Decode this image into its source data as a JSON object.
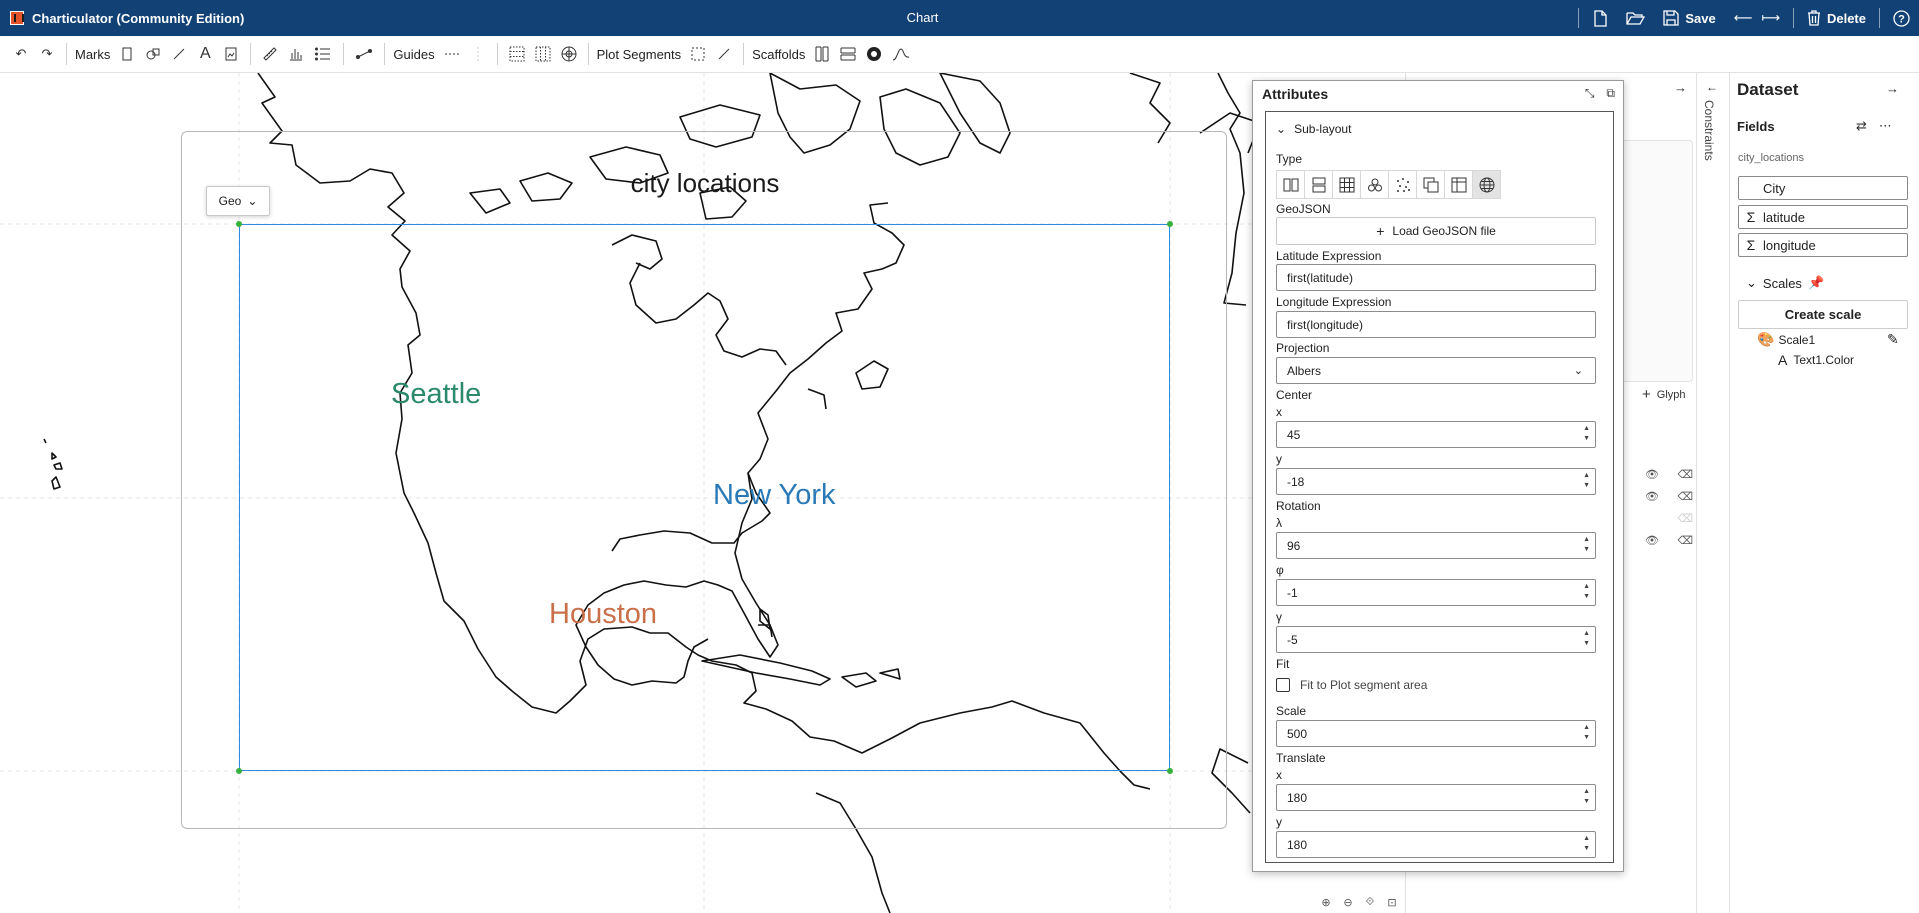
{
  "app": {
    "name": "Charticulator (Community Edition)",
    "document_title": "Chart",
    "actions": {
      "new_icon": "new-file-icon",
      "open_icon": "open-folder-icon",
      "save": "Save",
      "delete": "Delete",
      "help_icon": "help-icon"
    }
  },
  "toolbar": {
    "marks_label": "Marks",
    "guides_label": "Guides",
    "plot_segments_label": "Plot Segments",
    "scaffolds_label": "Scaffolds"
  },
  "canvas": {
    "chart_title": "city locations",
    "geo_dropdown": "Geo",
    "cities": [
      {
        "name": "Seattle",
        "color": "#2b8a6c"
      },
      {
        "name": "New York",
        "color": "#2a7ab7"
      },
      {
        "name": "Houston",
        "color": "#c96f49"
      }
    ]
  },
  "middle_panel": {
    "glyph_label": "Glyph",
    "constraints_label": "Constraints"
  },
  "attributes": {
    "title": "Attributes",
    "section": "Sub-layout",
    "type_label": "Type",
    "geojson_label": "GeoJSON",
    "load_geojson_button": "Load GeoJSON file",
    "latitude_expression_label": "Latitude Expression",
    "latitude_expression_value": "first(latitude)",
    "longitude_expression_label": "Longitude Expression",
    "longitude_expression_value": "first(longitude)",
    "projection_label": "Projection",
    "projection_value": "Albers",
    "center_label": "Center",
    "center_x_label": "x",
    "center_x": "45",
    "center_y_label": "y",
    "center_y": "-18",
    "rotation_label": "Rotation",
    "lambda_label": "λ",
    "lambda": "96",
    "phi_label": "φ",
    "phi": "-1",
    "gamma_label": "γ",
    "gamma": "-5",
    "fit_label": "Fit",
    "fit_checkbox_label": "Fit to Plot segment area",
    "fit_checked": false,
    "scale_label": "Scale",
    "scale": "500",
    "translate_label": "Translate",
    "translate_x_label": "x",
    "translate_x": "180",
    "translate_y_label": "y",
    "translate_y": "180"
  },
  "dataset": {
    "title": "Dataset",
    "fields_label": "Fields",
    "table_name": "city_locations",
    "fields": [
      {
        "name": "City",
        "type_icon": ""
      },
      {
        "name": "latitude",
        "type_icon": "Σ"
      },
      {
        "name": "longitude",
        "type_icon": "Σ"
      }
    ],
    "scales_label": "Scales",
    "create_scale_button": "Create scale",
    "scale_name": "Scale1",
    "scale_binding": "Text1.Color"
  }
}
